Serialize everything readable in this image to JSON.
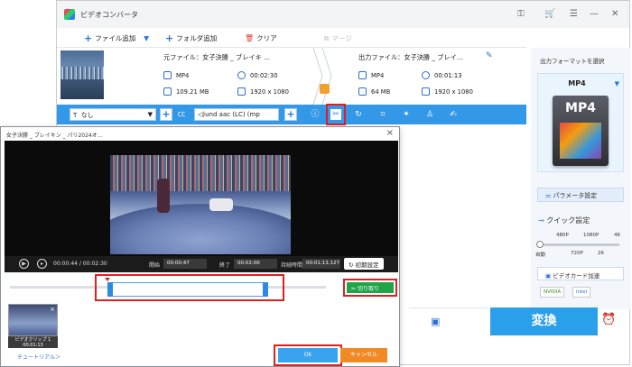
{
  "app": {
    "title": "ビデオコンバータ"
  },
  "toolbar": {
    "add_file": "ファイル追加",
    "add_folder": "フォルダ追加",
    "clear": "クリア",
    "merge": "マージ"
  },
  "source": {
    "label": "元ファイル：女子決勝 _ ブレイキ ...",
    "format": "MP4",
    "duration": "00:02:30",
    "size": "109.21 MB",
    "resolution": "1920 x 1080"
  },
  "output": {
    "label": "出力ファイル：女子決勝 _ ブレイ...",
    "format": "MP4",
    "duration": "00:01:13",
    "size": "64 MB",
    "resolution": "1920 x 1080"
  },
  "editbar": {
    "subtitle": "なし",
    "audio": "und aac (LC) (mp"
  },
  "right_panel": {
    "title": "出力フォーマットを選択",
    "format": "MP4",
    "param_button": "パラメータ設定",
    "quick_setting": "クイック設定",
    "levels": [
      "480P",
      "1080P",
      "4K"
    ],
    "levels_bottom": [
      "自動",
      "720P",
      "2K"
    ],
    "gpu_button": "ビデオカード加速",
    "badges": [
      "NVIDIA",
      "intel"
    ]
  },
  "convert_button": "変換",
  "dialog": {
    "title": "女子決勝 _ ブレイキン _ パリ2024オ...",
    "time_current": "00:00:44",
    "time_total": "00:02:30",
    "start_label": "開始",
    "start_value": "00:00:47",
    "end_label": "終了",
    "end_value": "00:02:00",
    "duration_label": "持続時間：",
    "duration_value": "00:01:13.127",
    "reset_button": "初期設定",
    "cut_button": "切り取り",
    "clip_label": "ビデオクリップ 1",
    "clip_time": "00:01:13",
    "tutorial_link": "チュートリアル＞",
    "ok_button": "Ok",
    "cancel_button": "キャンセル"
  },
  "colors": {
    "accent": "#2ba0ea",
    "highlight": "#e02020",
    "cut_green": "#1fa44a",
    "cancel_orange": "#f08a24"
  }
}
